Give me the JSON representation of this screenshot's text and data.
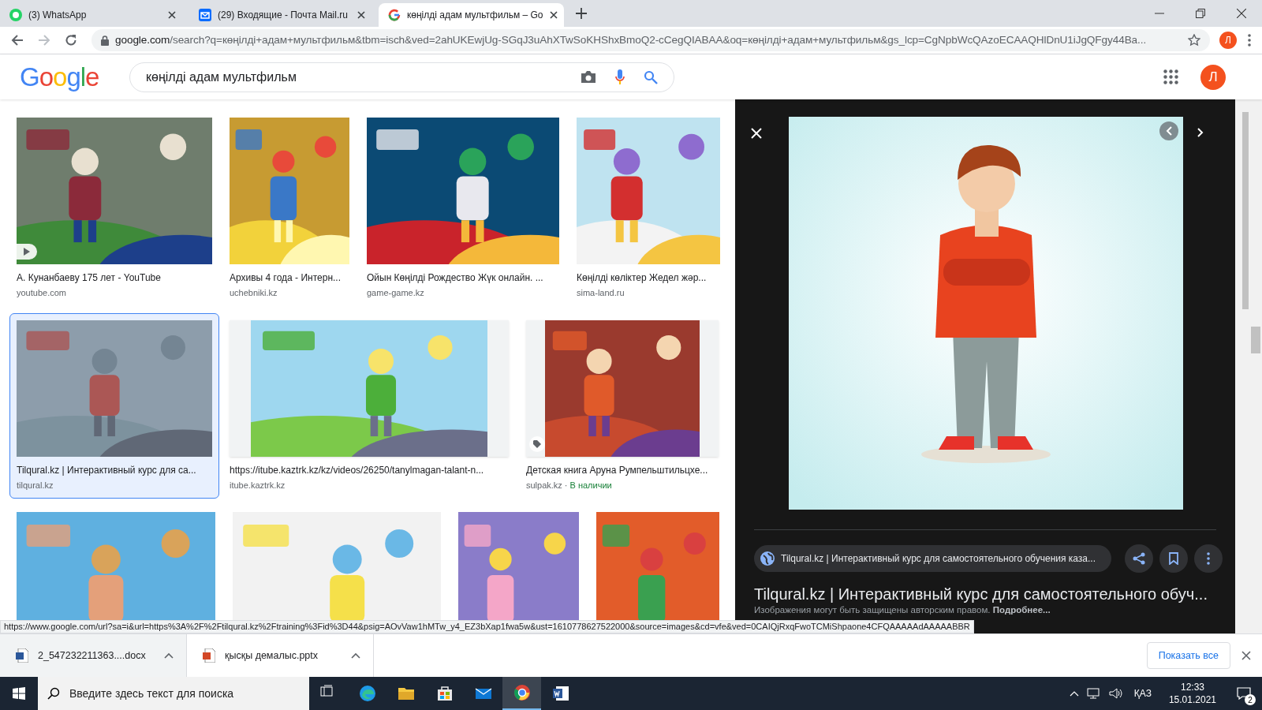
{
  "tabs": [
    {
      "title": "(3) WhatsApp",
      "kind": "whatsapp",
      "selected": false
    },
    {
      "title": "(29) Входящие - Почта Mail.ru",
      "kind": "mail",
      "selected": false
    },
    {
      "title": "көңілді адам мультфильм – Go",
      "kind": "google",
      "selected": true
    }
  ],
  "address": {
    "host": "google.com",
    "path": "/search?q=көңілді+адам+мультфильм&tbm=isch&ved=2ahUKEwjUg-SGqJ3uAhXTwSoKHShxBmoQ2-cCegQIABAA&oq=көңілді+адам+мультфильм&gs_lcp=CgNpbWcQAzoECAAQHlDnU1iJgQFgy44Ba...",
    "profile": "Л"
  },
  "google": {
    "logo": "Google",
    "query": "көңілді адам мультфильм",
    "avatar": "Л"
  },
  "rows": [
    {
      "items": [
        {
          "caption": "А. Кунанбаеву 175 лет - YouTube",
          "source": "youtube.com",
          "video": true,
          "selected": false
        },
        {
          "caption": "Архивы 4 года - Интерн...",
          "source": "uchebniki.kz",
          "selected": false
        },
        {
          "caption": "Ойын Көңілді Рождество Жүк онлайн. ...",
          "source": "game-game.kz",
          "selected": false
        },
        {
          "caption": "Көңілді көліктер Жедел жәр...",
          "source": "sima-land.ru",
          "selected": false
        }
      ]
    },
    {
      "items": [
        {
          "caption": "Tilqural.kz | Интерактивный курс для са...",
          "source": "tilqural.kz",
          "selected": true
        },
        {
          "caption": "https://itube.kaztrk.kz/kz/videos/26250/tanylmagan-talant-n...",
          "source": "itube.kaztrk.kz",
          "selected": false
        },
        {
          "caption": "Детская книга Аруна Румпельштильцхе...",
          "source": "sulpak.kz",
          "separator": "·",
          "availability": "В наличии",
          "product": true,
          "selected": false
        }
      ]
    },
    {
      "items": [
        {
          "selected": false
        },
        {
          "selected": false
        },
        {
          "selected": false
        },
        {
          "selected": false
        }
      ]
    }
  ],
  "preview": {
    "source_chip": "Tilqural.kz | Интерактивный курс для самостоятельного обучения каза...",
    "title": "Tilqural.kz | Интерактивный курс для самостоятельного обуч...",
    "note": "Изображения могут быть защищены авторским правом. **Подробнее...**"
  },
  "status_url": "https://www.google.com/url?sa=i&url=https%3A%2F%2Ftilqural.kz%2Ftraining%3Fid%3D44&psig=AOvVaw1hMTw_y4_EZ3bXap1fwa5w&ust=1610778627522000&source=images&cd=vfe&ved=0CAIQjRxqFwoTCMiShpaone4CFQAAAAAdAAAAABBR",
  "downloads": {
    "files": [
      {
        "name": "2_547232211363....docx",
        "kind": "docx"
      },
      {
        "name": "қысқы демалыс.pptx",
        "kind": "pptx"
      }
    ],
    "show_all": "Показать все"
  },
  "taskbar": {
    "search_placeholder": "Введите здесь текст для поиска",
    "apps": [
      {
        "kind": "taskview",
        "active": false
      },
      {
        "kind": "edge",
        "active": false
      },
      {
        "kind": "explorer",
        "active": false
      },
      {
        "kind": "store",
        "active": false
      },
      {
        "kind": "mail",
        "active": false
      },
      {
        "kind": "chrome",
        "active": true
      },
      {
        "kind": "word",
        "active": false
      }
    ],
    "language": "ҚАЗ",
    "time": "12:33",
    "date": "15.01.2021",
    "notifications": "2"
  }
}
